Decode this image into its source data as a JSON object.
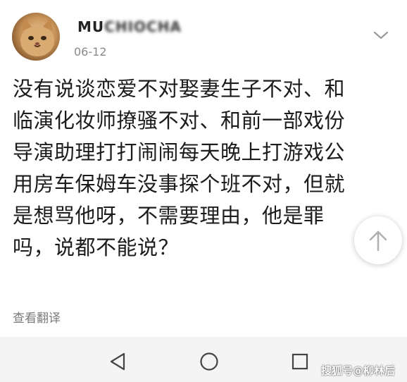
{
  "post": {
    "username": "MU",
    "username_hidden": "CHIOCHA",
    "date": "06-12",
    "lines": [
      "没有说谈恋爱不对娶妻生子不对、和",
      "临演化妆师撩骚不对、和前一部戏份",
      "导演助理打打闹闹每天晚上打游戏公",
      "用房车保姆车没事探个班不对，但就",
      "是想骂他呀，不需要理由，他是罪",
      "吗，说都不能说？"
    ],
    "translate_label": "查看翻译"
  },
  "icons": {
    "avatar": "cat-avatar",
    "menu": "chevron-down-icon",
    "scroll_top": "arrow-up-icon",
    "back": "back-triangle-icon",
    "home": "home-circle-icon",
    "recent": "recent-square-icon"
  },
  "watermark": "搜狐号@柳林后",
  "colors": {
    "text": "#1c1c1c",
    "muted": "#8a8a8a",
    "navbar": "#f4f4f4"
  }
}
